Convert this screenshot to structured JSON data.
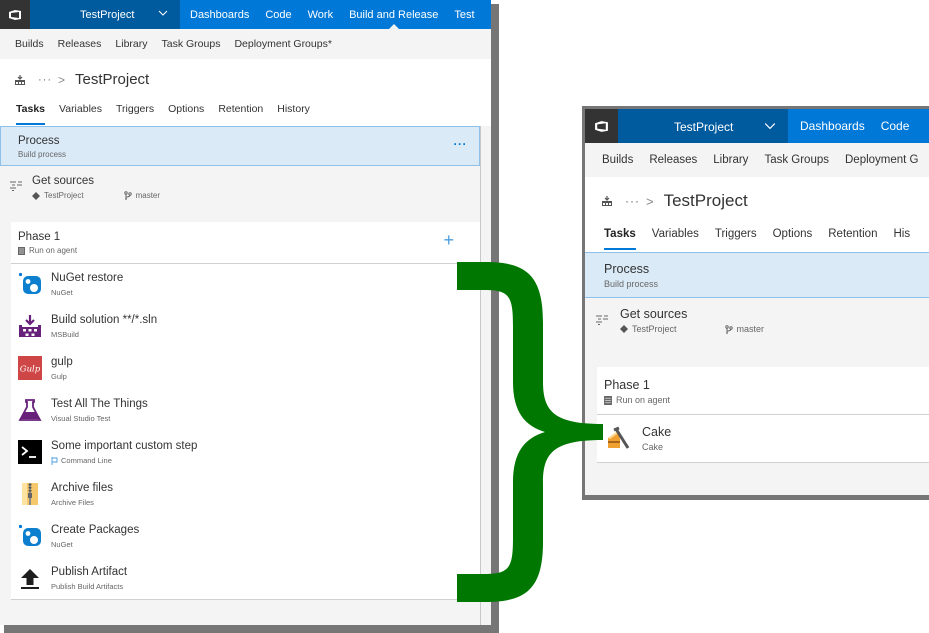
{
  "colors": {
    "accent": "#0078d7",
    "project_bg": "#005a9e",
    "logo_bg": "#333333",
    "selection_bg": "#daeaf7",
    "brace": "#007700",
    "shadow": "#767676"
  },
  "left_window": {
    "topbar": {
      "logo_icon": "vsts-logo-icon",
      "project": "TestProject",
      "nav": [
        "Dashboards",
        "Code",
        "Work",
        "Build and Release",
        "Test"
      ],
      "active_nav": "Build and Release"
    },
    "subnav": [
      "Builds",
      "Releases",
      "Library",
      "Task Groups",
      "Deployment Groups*"
    ],
    "breadcrumb": {
      "ellipsis": "···",
      "separator": ">",
      "title": "TestProject"
    },
    "tabs": [
      "Tasks",
      "Variables",
      "Triggers",
      "Options",
      "Retention",
      "History"
    ],
    "active_tab": "Tasks",
    "process": {
      "title": "Process",
      "subtitle": "Build process",
      "more": "···"
    },
    "get_sources": {
      "title": "Get sources",
      "repo": "TestProject",
      "branch": "master"
    },
    "phase": {
      "title": "Phase 1",
      "subtitle": "Run on agent",
      "add": "+",
      "tasks": [
        {
          "title": "NuGet restore",
          "subtitle": "NuGet",
          "icon": "nuget-icon"
        },
        {
          "title": "Build solution **/*.sln",
          "subtitle": "MSBuild",
          "icon": "msbuild-icon"
        },
        {
          "title": "gulp",
          "subtitle": "Gulp",
          "icon": "gulp-icon"
        },
        {
          "title": "Test All The Things",
          "subtitle": "Visual Studio Test",
          "icon": "flask-icon"
        },
        {
          "title": "Some important custom step",
          "subtitle": "Command Line",
          "icon": "terminal-icon"
        },
        {
          "title": "Archive files",
          "subtitle": "Archive Files",
          "icon": "zip-archive-icon"
        },
        {
          "title": "Create Packages",
          "subtitle": "NuGet",
          "icon": "nuget-icon"
        },
        {
          "title": "Publish Artifact",
          "subtitle": "Publish Build Artifacts",
          "icon": "upload-icon"
        }
      ]
    }
  },
  "right_window": {
    "topbar": {
      "project": "TestProject",
      "nav": [
        "Dashboards",
        "Code"
      ]
    },
    "subnav": [
      "Builds",
      "Releases",
      "Library",
      "Task Groups",
      "Deployment G"
    ],
    "breadcrumb": {
      "ellipsis": "···",
      "separator": ">",
      "title": "TestProject"
    },
    "tabs": [
      "Tasks",
      "Variables",
      "Triggers",
      "Options",
      "Retention",
      "His"
    ],
    "active_tab": "Tasks",
    "process": {
      "title": "Process",
      "subtitle": "Build process"
    },
    "get_sources": {
      "title": "Get sources",
      "repo": "TestProject",
      "branch": "master"
    },
    "phase": {
      "title": "Phase 1",
      "subtitle": "Run on agent",
      "tasks": [
        {
          "title": "Cake",
          "subtitle": "Cake",
          "icon": "cake-icon"
        }
      ]
    }
  },
  "annotation": {
    "shape": "right-curly-brace",
    "meaning": "left tasks replaced by single Cake task"
  }
}
